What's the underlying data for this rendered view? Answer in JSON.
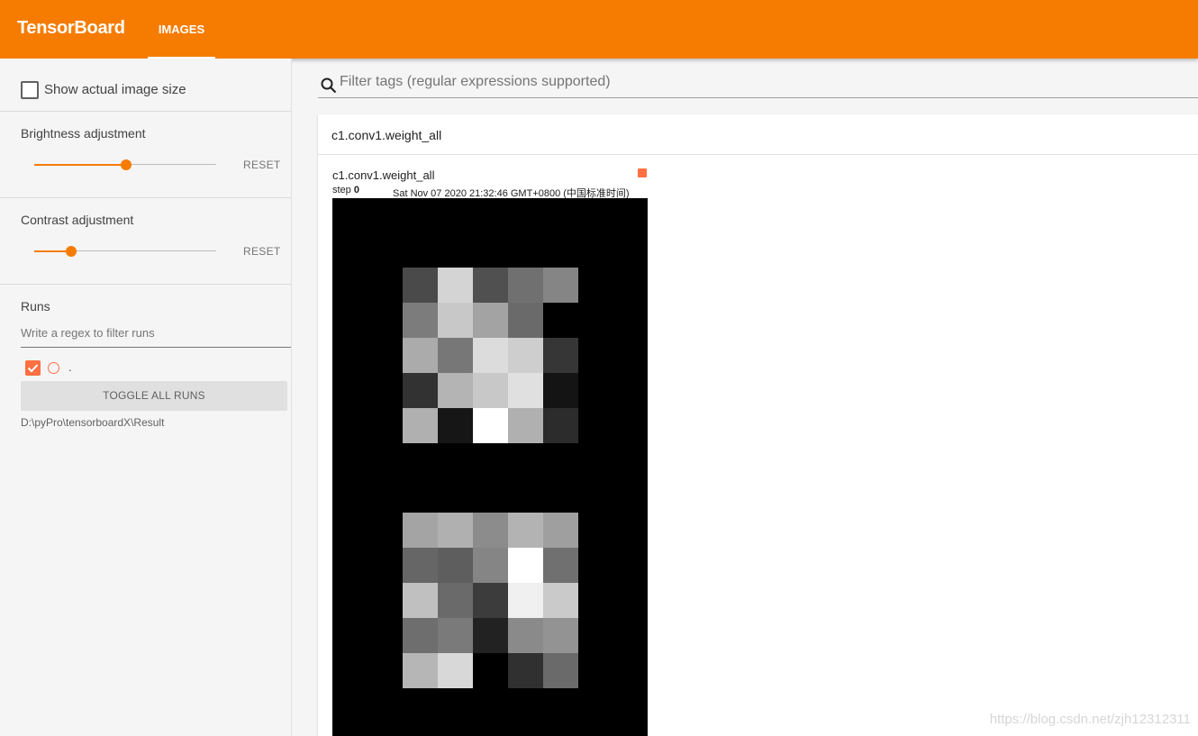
{
  "header": {
    "brand": "TensorBoard",
    "tabs": [
      {
        "label": "IMAGES",
        "active": true
      }
    ],
    "accent_color": "#f57c00"
  },
  "sidebar": {
    "show_actual_size_label": "Show actual image size",
    "show_actual_size_checked": false,
    "brightness": {
      "label": "Brightness adjustment",
      "reset": "RESET",
      "value_fraction": 0.5
    },
    "contrast": {
      "label": "Contrast adjustment",
      "reset": "RESET",
      "value_fraction": 0.2
    },
    "runs": {
      "title": "Runs",
      "filter_placeholder": "Write a regex to filter runs",
      "items": [
        {
          "label": ".",
          "checked": true,
          "color": "#ff7043"
        }
      ],
      "toggle_all_label": "TOGGLE ALL RUNS",
      "logdir": "D:\\pyPro\\tensorboardX\\Result"
    }
  },
  "main": {
    "filter_placeholder": "Filter tags (regular expressions supported)",
    "card": {
      "tag": "c1.conv1.weight_all",
      "image": {
        "title": "c1.conv1.weight_all",
        "step_label": "step",
        "step_value": "0",
        "timestamp": "Sat Nov 07 2020 21:32:46 GMT+0800 (中国标准时间)",
        "run_color": "#ff7043",
        "grids": [
          [
            [
              "#4a4a4a",
              "#d4d4d4",
              "#505050",
              "#707070",
              "#858585"
            ],
            [
              "#7c7c7c",
              "#c8c8c8",
              "#a3a3a3",
              "#6a6a6a",
              "#000000"
            ],
            [
              "#ababab",
              "#777777",
              "#dcdcdc",
              "#cecece",
              "#363636"
            ],
            [
              "#323232",
              "#b4b4b4",
              "#c8c8c8",
              "#e0e0e0",
              "#141414"
            ],
            [
              "#b0b0b0",
              "#161616",
              "#ffffff",
              "#b0b0b0",
              "#2c2c2c"
            ]
          ],
          [
            [
              "#a4a4a4",
              "#b0b0b0",
              "#8c8c8c",
              "#b3b3b3",
              "#9f9f9f"
            ],
            [
              "#666666",
              "#5e5e5e",
              "#858585",
              "#ffffff",
              "#707070"
            ],
            [
              "#c0c0c0",
              "#6a6a6a",
              "#3c3c3c",
              "#f0f0f0",
              "#cacaca"
            ],
            [
              "#6e6e6e",
              "#7a7a7a",
              "#222222",
              "#8a8a8a",
              "#939393"
            ],
            [
              "#b6b6b6",
              "#d8d8d8",
              "#000000",
              "#303030",
              "#6a6a6a"
            ]
          ]
        ]
      }
    }
  },
  "watermark": "https://blog.csdn.net/zjh12312311"
}
